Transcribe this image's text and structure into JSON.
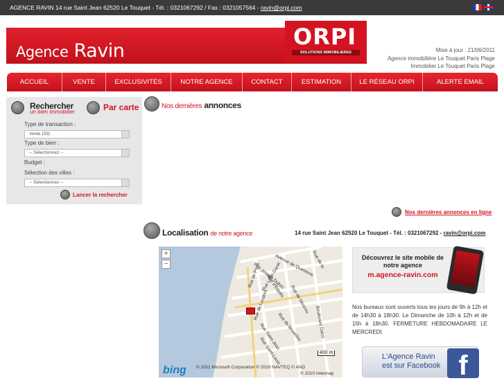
{
  "topbar": {
    "text": "AGENCE RAVIN 14 rue Saint Jean 62520 Le Touquet - Tél. : 0321067292 / Fax : 0321057564 - ",
    "email": "ravin@orpi.com"
  },
  "header": {
    "brand_prefix": "Agence",
    "brand_name": "Ravin",
    "logo_word": "ORPI",
    "logo_tag": "SOLUTIONS IMMOBILIERES",
    "update": "Mise à jour : 21/06/2011",
    "subtitle1": "Agence immobilière Le Touquet Paris Plage",
    "subtitle2": "Immobilier Le Touquet Paris Plage"
  },
  "nav": [
    "ACCUEIL",
    "VENTE",
    "EXCLUSIVITÉS",
    "NOTRE AGENCE",
    "CONTACT",
    "ESTIMATION",
    "LE RÉSEAU ORPI",
    "ALERTE EMAIL"
  ],
  "search": {
    "title": "Rechercher",
    "subtitle": "un bien immobilier",
    "map_link": "Par carte",
    "transaction_label": "Type de transaction :",
    "transaction_value": "Vente (59)",
    "type_label": "Type de bien :",
    "type_value": "-- Sélectionnez --",
    "budget_label": "Budget :",
    "cities_label": "Sélection des villes :",
    "cities_value": "-- Sélectionnez --",
    "launch": "Lancer la rechercher"
  },
  "annonces": {
    "title_red": "Nos dernières",
    "title_bold": "annonces",
    "link": "Nos dernières annonces en ligne"
  },
  "localisation": {
    "title": "Localisation",
    "title_red": "de notre agence",
    "address": "14 rue Saint Jean 62520 Le Touquet - Tél. : 0321067292 - ",
    "email": "ravin@orpi.com"
  },
  "map": {
    "streets": [
      "Avenue de Quentovic",
      "Rue Joseph Duboc",
      "Rue d'Espiés",
      "Rue de Moscou",
      "Rue Léon Garet",
      "Rue de Paris",
      "Rue de Londres",
      "Rue de Bruxelles",
      "Rue Saint-Jean",
      "Rue Saint-Louis",
      "Boulevard Daloz",
      "Rue de la"
    ],
    "scale": "400 m",
    "copyright1": "© 2011 Microsoft Corporation   © 2010 NAVTEQ   © AND",
    "copyright2": "© 2010 Intermap",
    "bing": "bing"
  },
  "mobile": {
    "text": "Découvrez le site mobile de notre agence",
    "url": "m.agence-ravin.com"
  },
  "hours": "Nos bureaux sont ouverts tous les jours de 9h à 12h et de 14h30 à 18h30. Le Dimanche de 10h à 12h et de 15h à 18h30. FERMETURE HEBDOMADAIRE LE MERCREDI.",
  "facebook": {
    "line1": "L'Agence Ravin",
    "line2": "est sur Facebook",
    "logo": "f"
  }
}
